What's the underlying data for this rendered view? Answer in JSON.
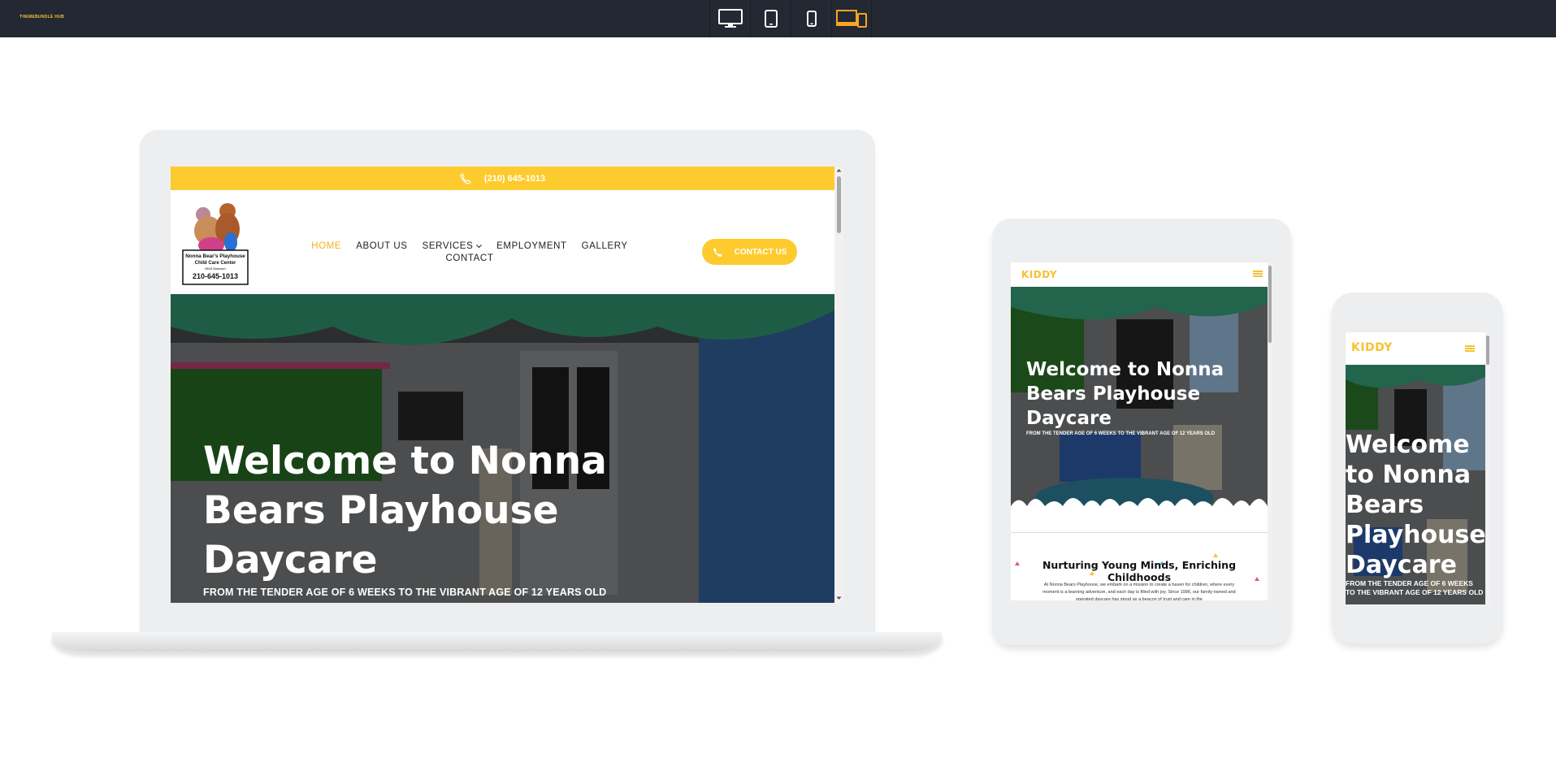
{
  "toolbar": {
    "brand": "THEMEBUNDLE HUB",
    "devices": [
      {
        "name": "desktop",
        "icon": "desktop-icon"
      },
      {
        "name": "tablet",
        "icon": "tablet-icon"
      },
      {
        "name": "mobile",
        "icon": "mobile-icon"
      },
      {
        "name": "responsive",
        "icon": "responsive-devices-icon",
        "active": true
      }
    ]
  },
  "site": {
    "phone": "(210) 645-1013",
    "nav": {
      "home": "HOME",
      "about": "ABOUT US",
      "services": "SERVICES",
      "employment": "EMPLOYMENT",
      "gallery": "GALLERY",
      "contact": "CONTACT"
    },
    "contact_button": "CONTACT US",
    "logo": {
      "line1": "Nonna Bear's Playhouse",
      "line2": "Child Care Center",
      "line3": "9826 Marbach",
      "phone": "210-645-1013"
    },
    "hero": {
      "title": "Welcome to Nonna Bears Playhouse Daycare",
      "subtitle": "FROM THE TENDER AGE OF 6 WEEKS TO THE VIBRANT AGE OF 12 YEARS OLD"
    },
    "mobile_logo": "KIDDY",
    "section": {
      "heading": "Nurturing Young Minds, Enriching Childhoods",
      "body": "At Nonna Bears Playhouse, we embark on a mission to create a haven for children, where every moment is a learning adventure, and each day is filled with joy. Since 1996, our family-owned and operated daycare has stood as a beacon of trust and care in the"
    }
  },
  "colors": {
    "toolbar_bg": "#232832",
    "accent_yellow": "#fdcb2d",
    "nav_active": "#f2b21c",
    "device_frame": "#eceef0"
  }
}
